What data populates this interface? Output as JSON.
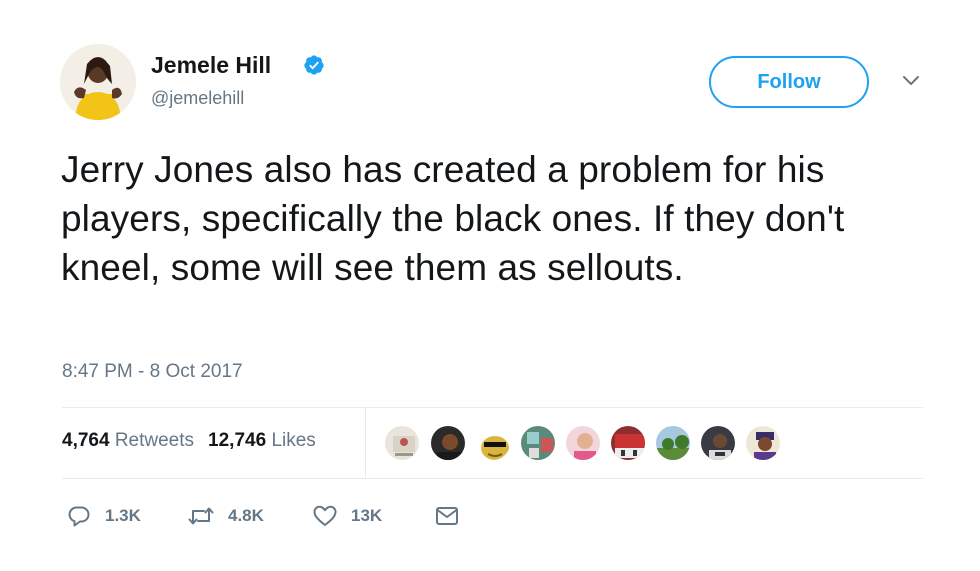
{
  "user": {
    "display_name": "Jemele Hill",
    "handle": "@jemelehill",
    "verified": true
  },
  "follow_label": "Follow",
  "tweet": {
    "text": "Jerry Jones also has created a problem for his players, specifically the black ones. If they don't kneel, some will see them as sellouts.",
    "timestamp": "8:47 PM - 8 Oct 2017"
  },
  "stats": {
    "retweets_count": "4,764",
    "retweets_label": "Retweets",
    "likes_count": "12,746",
    "likes_label": "Likes"
  },
  "actions": {
    "replies": "1.3K",
    "retweets": "4.8K",
    "likes": "13K"
  },
  "colors": {
    "accent": "#1da1f2",
    "muted": "#657786",
    "text": "#14171a",
    "divider": "#e6ecf0"
  },
  "icons": [
    "verified-badge-icon",
    "chevron-down-icon",
    "reply-icon",
    "retweet-icon",
    "like-heart-icon",
    "direct-message-icon"
  ]
}
